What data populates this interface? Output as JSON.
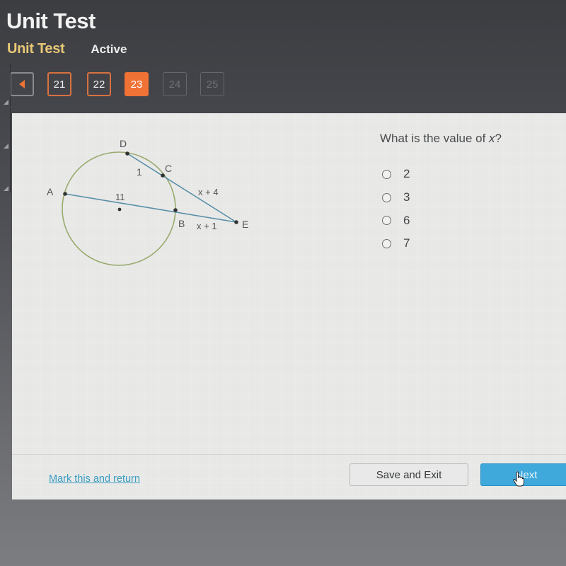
{
  "header": {
    "title": "Unit Test",
    "test_name": "Unit Test",
    "status": "Active"
  },
  "question_nav": {
    "back_icon": "triangle-left-icon",
    "items": [
      {
        "label": "21",
        "state": "visited"
      },
      {
        "label": "22",
        "state": "visited"
      },
      {
        "label": "23",
        "state": "current"
      },
      {
        "label": "24",
        "state": "locked"
      },
      {
        "label": "25",
        "state": "locked"
      }
    ]
  },
  "colors": {
    "accent_orange": "#f07234",
    "title_gold": "#e8c877",
    "next_blue": "#3fa9dc",
    "link_blue": "#3a9cc1",
    "circle_green": "#9aaa6e",
    "segment_blue": "#5a8fa8"
  },
  "diagram": {
    "points": {
      "A": "A",
      "B": "B",
      "C": "C",
      "D": "D",
      "E": "E"
    },
    "labels": {
      "DC": "1",
      "CE": "x + 4",
      "AB": "11",
      "BE": "x + 1"
    }
  },
  "question": {
    "prefix": "What is the value of ",
    "variable": "x",
    "suffix": "?",
    "options": [
      "2",
      "3",
      "6",
      "7"
    ]
  },
  "footer": {
    "mark_link": "Mark this and return",
    "save_label": "Save and Exit",
    "next_label": "Next"
  }
}
